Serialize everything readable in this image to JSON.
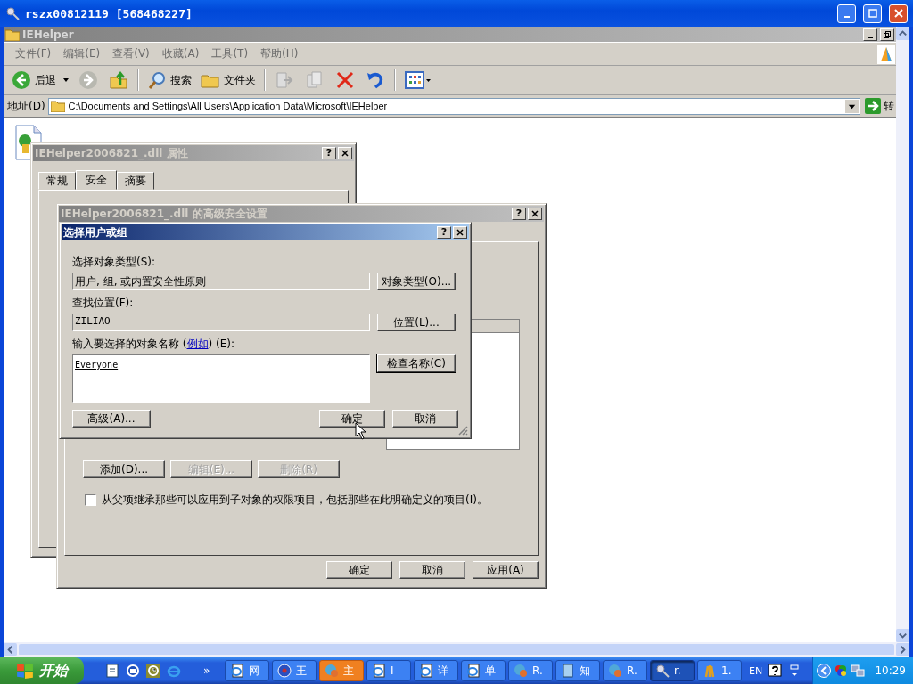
{
  "window": {
    "title": "rszx00812119 [568468227]"
  },
  "explorer": {
    "title": "IEHelper",
    "menu": [
      "文件(F)",
      "编辑(E)",
      "查看(V)",
      "收藏(A)",
      "工具(T)",
      "帮助(H)"
    ],
    "toolbar": {
      "back": "后退",
      "search": "搜索",
      "folders": "文件夹"
    },
    "address": {
      "label": "地址(D)",
      "value": "C:\\Documents and Settings\\All Users\\Application Data\\Microsoft\\IEHelper",
      "go": "转"
    }
  },
  "properties_dialog": {
    "title": "IEHelper2006821_.dll 属性",
    "help": "?",
    "tabs": [
      {
        "label": "常规",
        "selected": false
      },
      {
        "label": "安全",
        "selected": true
      },
      {
        "label": "摘要",
        "selected": false
      }
    ]
  },
  "advanced_dialog": {
    "title": "IEHelper2006821_.dll 的高级安全设置",
    "help": "?",
    "buttons": [
      {
        "label": "添加(D)...",
        "disabled": false
      },
      {
        "label": "编辑(E)...",
        "disabled": true
      },
      {
        "label": "删除(R)",
        "disabled": true
      }
    ],
    "inherit": {
      "label": "从父项继承那些可以应用到子对象的权限项目，包括那些在此明确定义的项目(I)。",
      "checked": false
    },
    "footer": [
      "确定",
      "取消",
      "应用(A)"
    ]
  },
  "select_dialog": {
    "title": "选择用户或组",
    "help": "?",
    "object_type_label": "选择对象类型(S):",
    "object_type": "用户, 组, 或内置安全性原则",
    "object_type_button": "对象类型(O)...",
    "location_label": "查找位置(F):",
    "location": "ZILIAO",
    "location_button": "位置(L)...",
    "names_label_before": "输入要选择的对象名称 (",
    "names_link": "例如",
    "names_label_after": ") (E):",
    "names_value": "Everyone",
    "check_button": "检查名称(C)",
    "advanced_button": "高级(A)...",
    "ok": "确定",
    "cancel": "取消"
  },
  "taskbar": {
    "start": "开始",
    "more": "»",
    "buttons": [
      {
        "label": "网",
        "kind": "ie",
        "selected": false,
        "flashing": false
      },
      {
        "label": "王",
        "kind": "disc",
        "selected": false,
        "flashing": false
      },
      {
        "label": "主",
        "kind": "globe",
        "selected": false,
        "flashing": true
      },
      {
        "label": "I",
        "kind": "ie",
        "selected": false,
        "flashing": false
      },
      {
        "label": "详",
        "kind": "ie",
        "selected": false,
        "flashing": false
      },
      {
        "label": "单",
        "kind": "ie",
        "selected": false,
        "flashing": false
      },
      {
        "label": "R.",
        "kind": "globe",
        "selected": false,
        "flashing": false
      },
      {
        "label": "知",
        "kind": "notepad",
        "selected": false,
        "flashing": false
      },
      {
        "label": "R.",
        "kind": "globe",
        "selected": false,
        "flashing": false
      },
      {
        "label": "r.",
        "kind": "magnifier",
        "selected": true,
        "flashing": false
      },
      {
        "label": "1.",
        "kind": "pencils",
        "selected": false,
        "flashing": false
      }
    ],
    "language": "EN",
    "clock": "10:29"
  }
}
